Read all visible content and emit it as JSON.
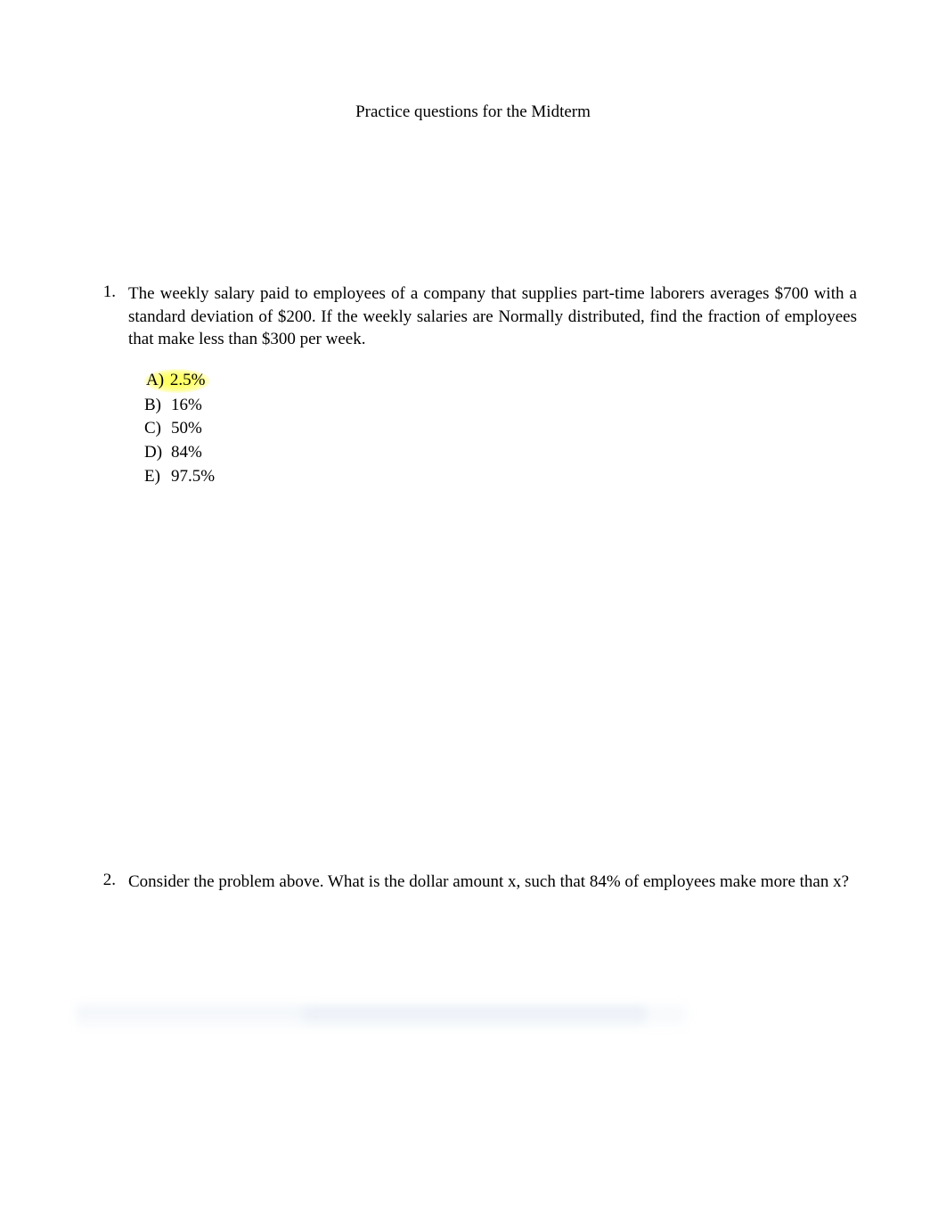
{
  "title": "Practice questions for the Midterm",
  "questions": [
    {
      "number": "1.",
      "text": "The weekly salary paid to employees of a company that supplies part-time laborers averages $700 with a standard deviation of $200.  If the weekly salaries are Normally distributed, find the fraction of employees that make less than $300 per week.",
      "options": [
        {
          "letter": "A)",
          "value": "2.5%",
          "highlighted": true
        },
        {
          "letter": "B)",
          "value": "16%",
          "highlighted": false
        },
        {
          "letter": "C)",
          "value": "50%",
          "highlighted": false
        },
        {
          "letter": "D)",
          "value": "84%",
          "highlighted": false
        },
        {
          "letter": "E)",
          "value": "97.5%",
          "highlighted": false
        }
      ]
    },
    {
      "number": "2.",
      "text": "Consider the problem above.  What is the dollar amount x, such that 84% of employees make more than x?",
      "options": []
    }
  ]
}
